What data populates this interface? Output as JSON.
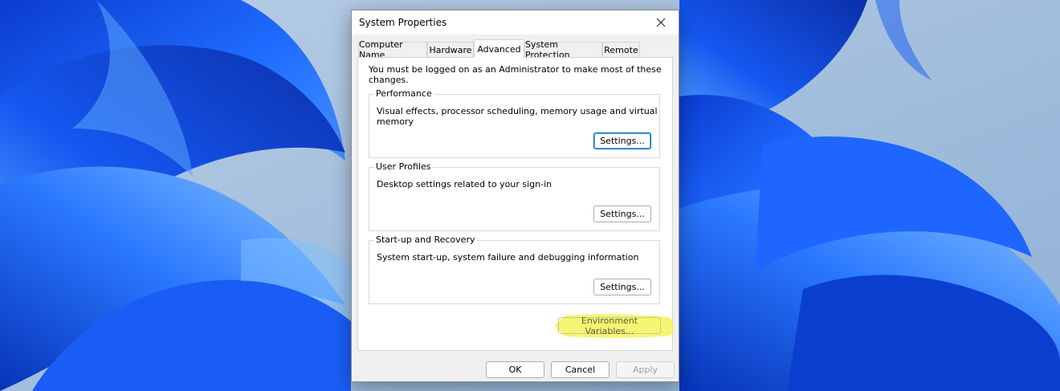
{
  "window": {
    "title": "System Properties",
    "close_icon": "close-icon"
  },
  "tabs": [
    {
      "label": "Computer Name",
      "active": false
    },
    {
      "label": "Hardware",
      "active": false
    },
    {
      "label": "Advanced",
      "active": true
    },
    {
      "label": "System Protection",
      "active": false
    },
    {
      "label": "Remote",
      "active": false
    }
  ],
  "advanced": {
    "admin_note": "You must be logged on as an Administrator to make most of these changes.",
    "performance": {
      "label": "Performance",
      "description": "Visual effects, processor scheduling, memory usage and virtual memory",
      "settings_label": "Settings..."
    },
    "user_profiles": {
      "label": "User Profiles",
      "description": "Desktop settings related to your sign-in",
      "settings_label": "Settings..."
    },
    "startup_recovery": {
      "label": "Start-up and Recovery",
      "description": "System start-up, system failure and debugging information",
      "settings_label": "Settings..."
    },
    "environment_variables_label": "Environment Variables..."
  },
  "footer": {
    "ok_label": "OK",
    "cancel_label": "Cancel",
    "apply_label": "Apply",
    "apply_enabled": false
  },
  "colors": {
    "highlight": "#f3f35a",
    "focus_border": "#0067c0",
    "wallpaper_blue": "#1556e8"
  }
}
